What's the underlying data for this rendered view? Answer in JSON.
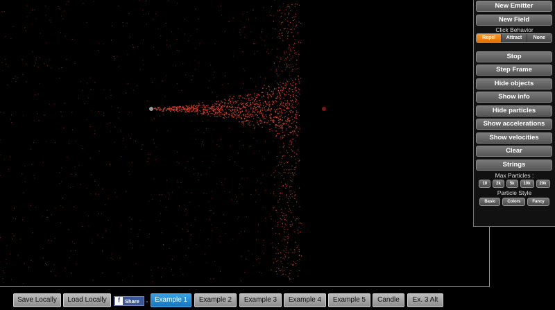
{
  "panel": {
    "new_emitter": "New Emitter",
    "new_field": "New Field",
    "click_behavior_label": "Click Behavior",
    "click_behavior_options": [
      "Repel",
      "Attract",
      "None"
    ],
    "click_behavior_selected": "Repel",
    "stop": "Stop",
    "step_frame": "Step Frame",
    "hide_objects": "Hide objects",
    "show_info": "Show info",
    "hide_particles": "Hide particles",
    "show_accelerations": "Show accelerations",
    "show_velocities": "Show velocities",
    "clear": "Clear",
    "strings": "Strings",
    "max_particles_label": "Max Particles :",
    "max_particles_options": [
      "10",
      "2k",
      "5k",
      "10k",
      "20k"
    ],
    "particle_style_label": "Particle Style",
    "particle_style_options": [
      "Basic",
      "Colors",
      "Fancy"
    ]
  },
  "bottom": {
    "save_locally": "Save Locally",
    "load_locally": "Load Locally",
    "share_label": "Share",
    "share_icon_letter": "f",
    "separator": "-",
    "examples": [
      "Example 1",
      "Example 2",
      "Example 3",
      "Example 4",
      "Example 5",
      "Candle",
      "Ex. 3 Alt"
    ],
    "active_example": "Example 1"
  },
  "colors": {
    "background": "#000000",
    "particle": "#e0452a",
    "active_segment": "#ff8c1a",
    "active_example": "#1f8ad4",
    "facebook": "#3b5998"
  },
  "icons": {
    "emitter": "emitter-dot-icon",
    "field": "field-dot-icon",
    "facebook": "facebook-icon"
  }
}
